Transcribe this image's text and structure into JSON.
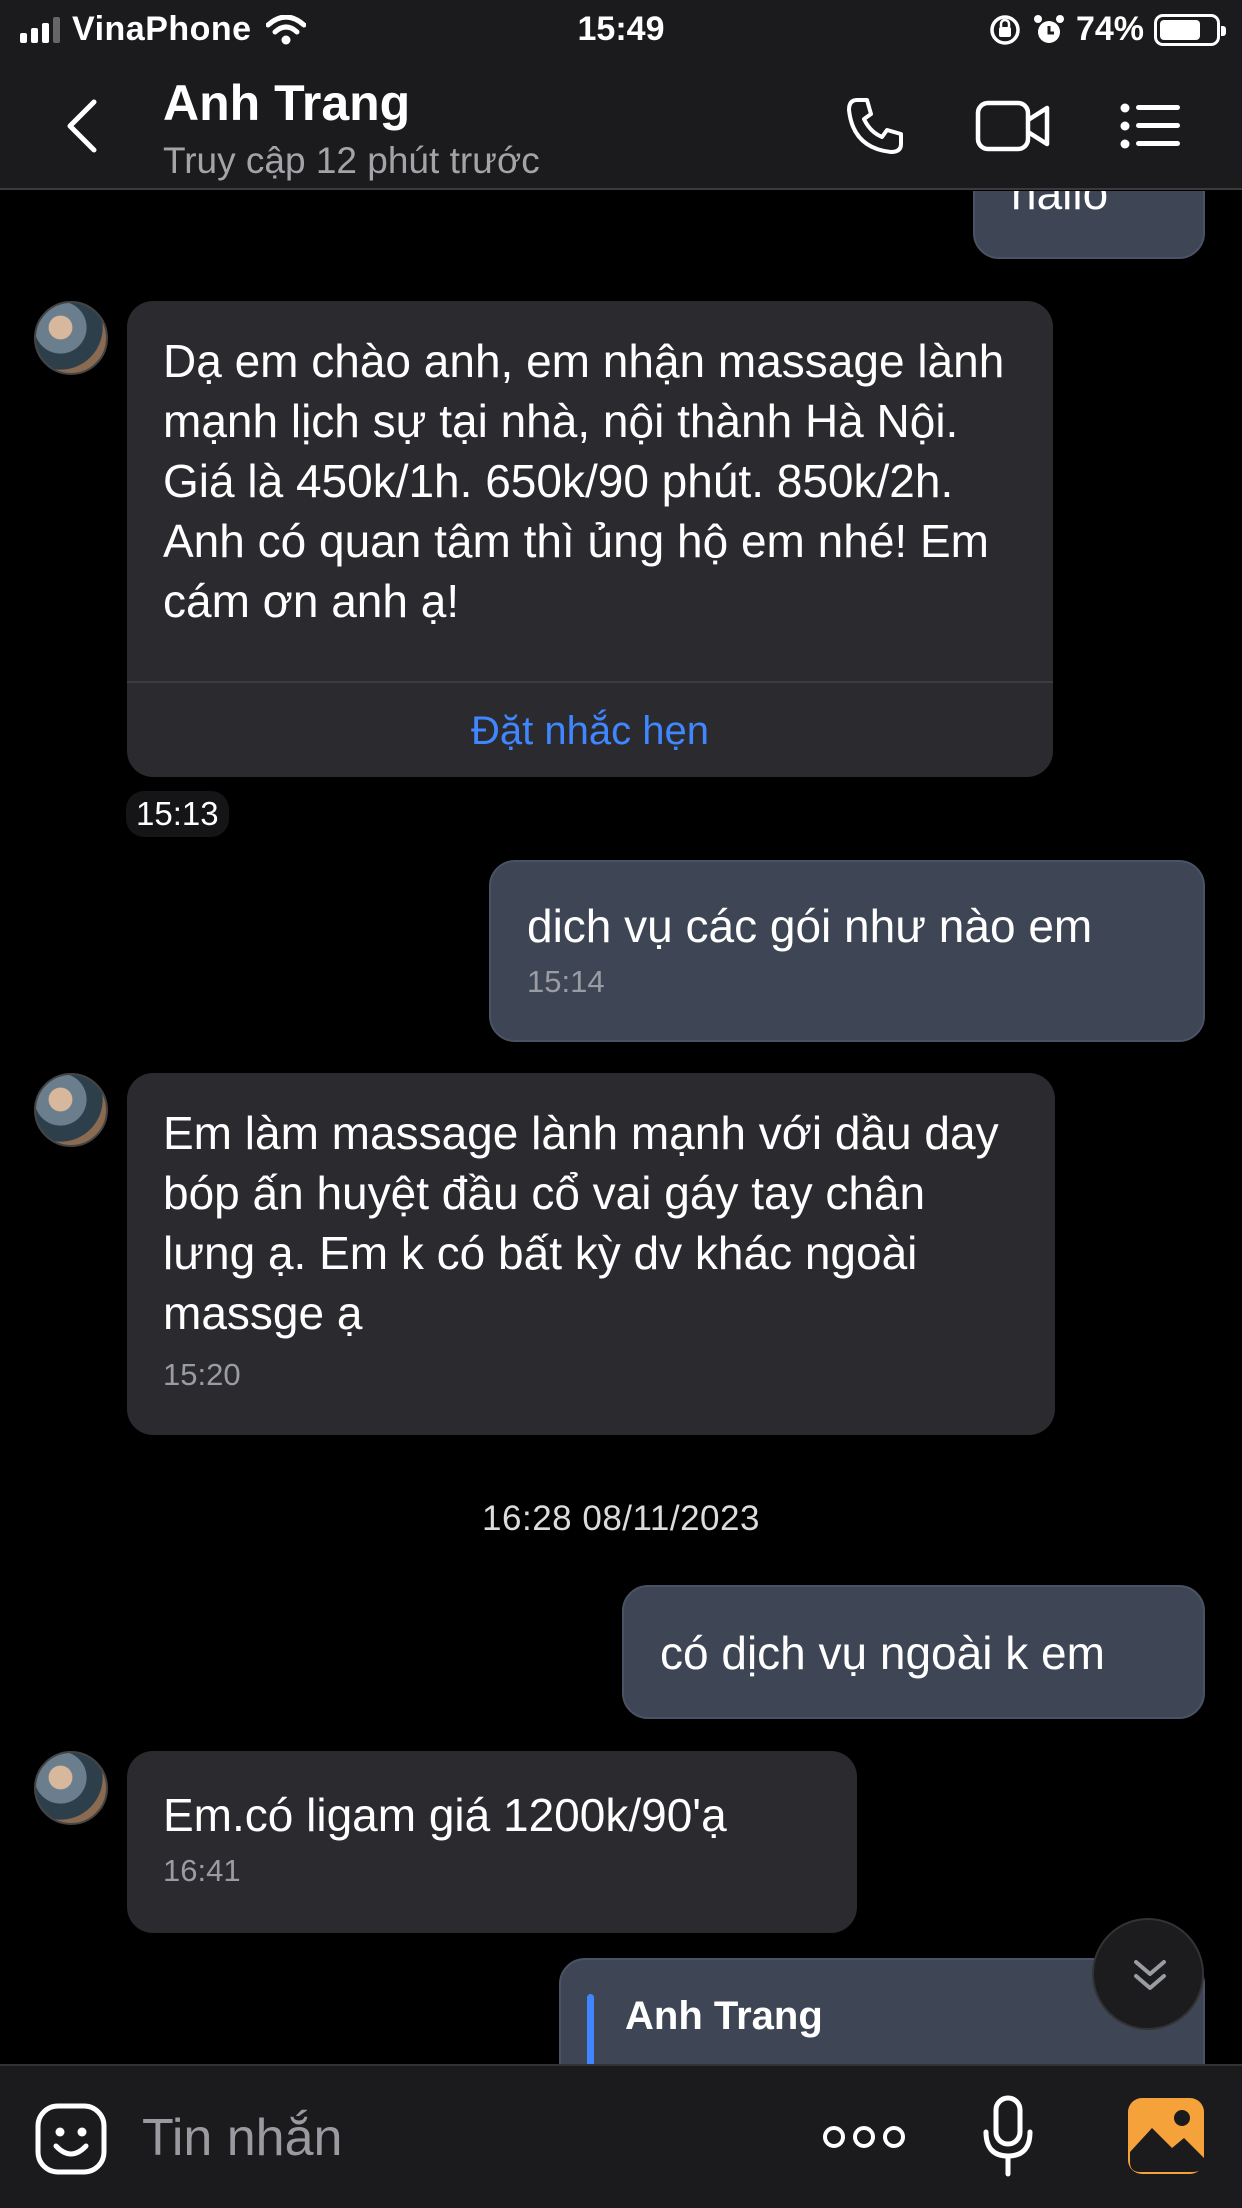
{
  "status_bar": {
    "carrier": "VinaPhone",
    "time": "15:49",
    "battery_percent": "74%",
    "battery_level": 0.74,
    "icons": [
      "cellular-signal-icon",
      "wifi-icon",
      "orientation-lock-icon",
      "alarm-icon",
      "battery-icon"
    ]
  },
  "header": {
    "contact_name": "Anh Trang",
    "last_seen": "Truy cập 12 phút trước",
    "icons": [
      "back-chevron-icon",
      "phone-call-icon",
      "video-call-icon",
      "menu-list-icon"
    ]
  },
  "messages": [
    {
      "direction": "out",
      "text": "hallo",
      "time": ""
    },
    {
      "direction": "in",
      "text": "Dạ em chào anh, em nhận massage lành mạnh lịch sự tại nhà, nội thành Hà Nội. Giá là 450k/1h. 650k/90 phút. 850k/2h. Anh có quan tâm thì ủng hộ em nhé! Em cám ơn anh ạ!",
      "action": "Đặt nhắc hẹn",
      "time": "15:13"
    },
    {
      "direction": "out",
      "text": "dich vụ các gói như nào em",
      "time": "15:14"
    },
    {
      "direction": "in",
      "text": "Em làm massage lành mạnh với dầu day bóp ấn huyệt đầu cổ vai gáy tay chân lưng ạ. Em k có bất kỳ dv khác ngoài massge ạ",
      "time": "15:20"
    },
    {
      "direction": "out",
      "text": "có dịch vụ ngoài k em",
      "time": ""
    },
    {
      "direction": "in",
      "text": "Em.có ligam giá 1200k/90'ạ",
      "time": "16:41"
    },
    {
      "direction": "out",
      "quote_name": "Anh Trang"
    }
  ],
  "date_separator": "16:28 08/11/2023",
  "input": {
    "placeholder": "Tin nhắn",
    "icons": [
      "sticker-icon",
      "more-dots-icon",
      "microphone-icon",
      "gallery-image-icon"
    ]
  },
  "colors": {
    "background": "#000000",
    "bar": "#1b1b1d",
    "incoming_bubble": "#2b2b2f",
    "outgoing_bubble": "#3e4554",
    "accent": "#3f86ff",
    "gallery_icon": "#f5a23a"
  }
}
